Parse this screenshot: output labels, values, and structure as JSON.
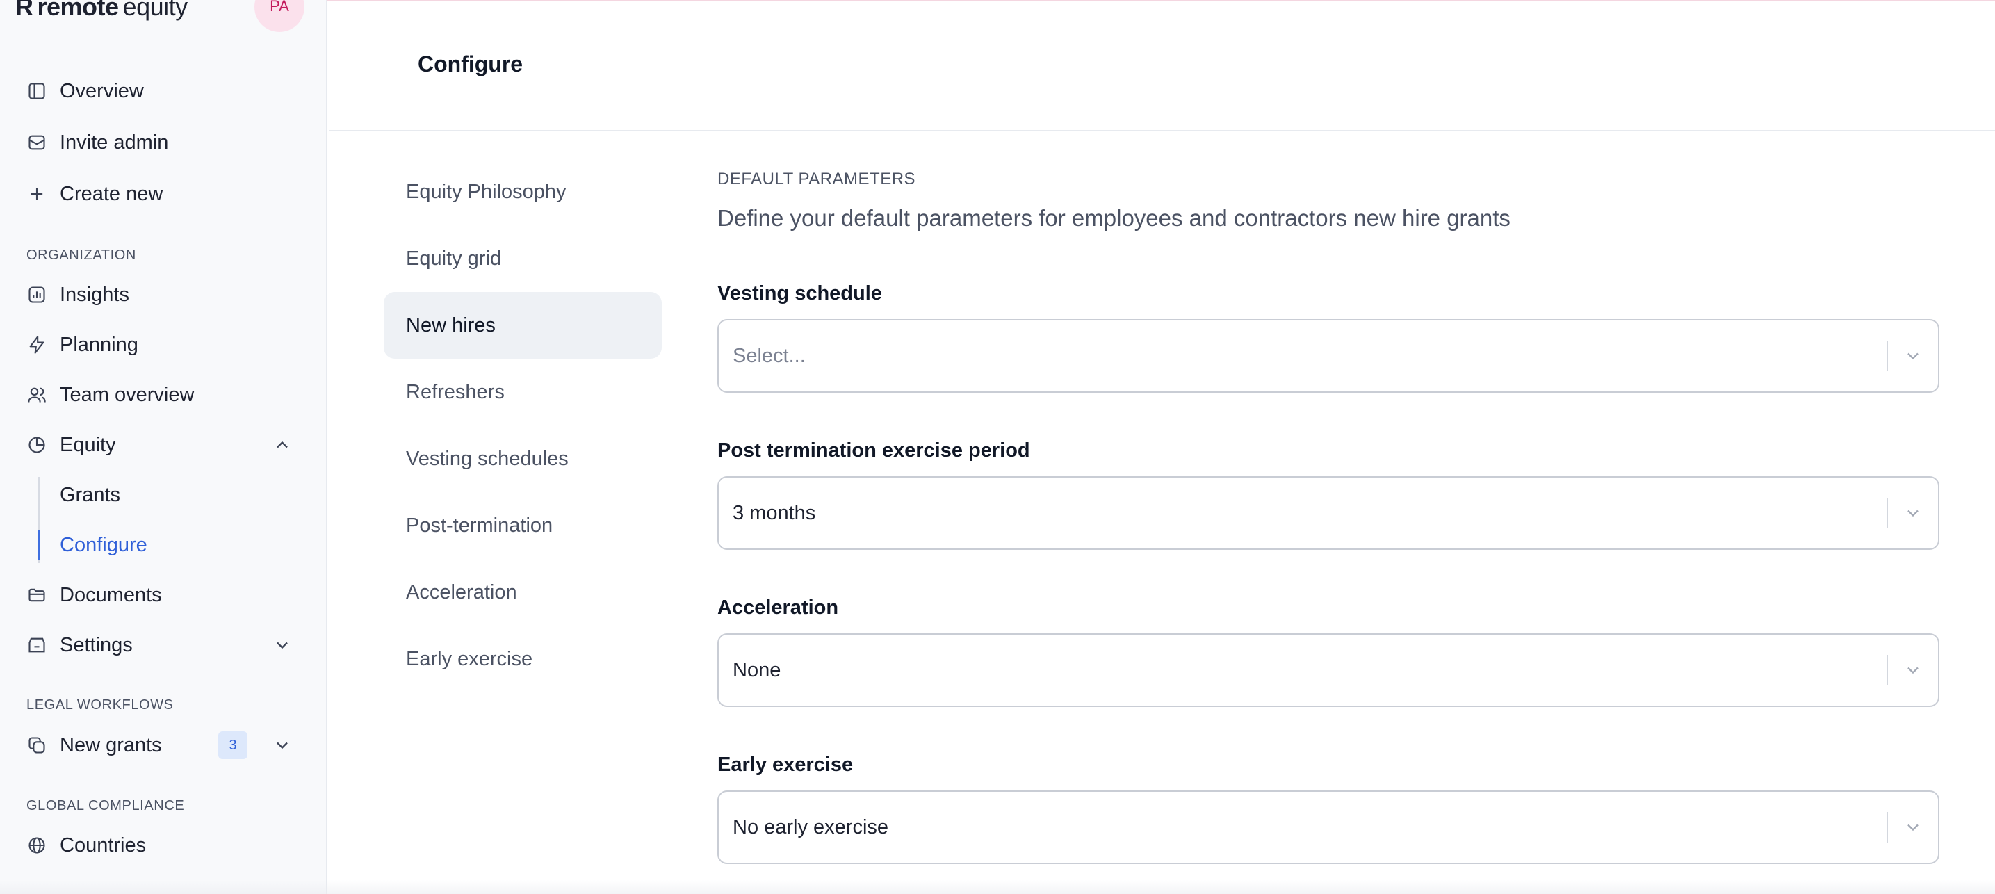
{
  "app": {
    "logo_text": "remote equity",
    "logo_mark": "R",
    "logo_brand": "remote",
    "logo_product": "equity",
    "avatar_initials": "PA"
  },
  "sidebar": {
    "top_items": [
      {
        "label": "Overview",
        "icon": "layout-icon"
      },
      {
        "label": "Invite admin",
        "icon": "mail-icon"
      },
      {
        "label": "Create new",
        "icon": "plus-icon"
      }
    ],
    "organization_label": "ORGANIZATION",
    "organization_items": [
      {
        "label": "Insights",
        "icon": "chart-icon"
      },
      {
        "label": "Planning",
        "icon": "bolt-icon"
      },
      {
        "label": "Team overview",
        "icon": "users-icon"
      },
      {
        "label": "Equity",
        "icon": "pie-icon",
        "expanded": true
      },
      {
        "label": "Documents",
        "icon": "folder-icon"
      },
      {
        "label": "Settings",
        "icon": "settings-icon",
        "expanded": false
      }
    ],
    "equity_sub_items": [
      {
        "label": "Grants",
        "active": false
      },
      {
        "label": "Configure",
        "active": true
      }
    ],
    "legal_label": "LEGAL WORKFLOWS",
    "legal_items": [
      {
        "label": "New grants",
        "icon": "copy-icon",
        "badge": "3"
      }
    ],
    "compliance_label": "GLOBAL COMPLIANCE",
    "compliance_items": [
      {
        "label": "Countries",
        "icon": "globe-icon"
      }
    ]
  },
  "header": {
    "title": "Configure"
  },
  "subnav": {
    "items": [
      {
        "label": "Equity Philosophy",
        "active": false
      },
      {
        "label": "Equity grid",
        "active": false
      },
      {
        "label": "New hires",
        "active": true
      },
      {
        "label": "Refreshers",
        "active": false
      },
      {
        "label": "Vesting schedules",
        "active": false
      },
      {
        "label": "Post-termination",
        "active": false
      },
      {
        "label": "Acceleration",
        "active": false
      },
      {
        "label": "Early exercise",
        "active": false
      }
    ]
  },
  "main": {
    "kicker": "DEFAULT PARAMETERS",
    "lead": "Define your default parameters for employees and contractors new hire grants",
    "fields": [
      {
        "label": "Vesting schedule",
        "value": "",
        "placeholder": "Select..."
      },
      {
        "label": "Post termination exercise period",
        "value": "3 months",
        "placeholder": ""
      },
      {
        "label": "Acceleration",
        "value": "None",
        "placeholder": ""
      },
      {
        "label": "Early exercise",
        "value": "No early exercise",
        "placeholder": ""
      }
    ]
  },
  "colors": {
    "accent": "#2f5fd8",
    "avatar_bg": "#fbe1ec",
    "avatar_text": "#c2185b",
    "sidebar_bg": "#f8f9fb"
  }
}
